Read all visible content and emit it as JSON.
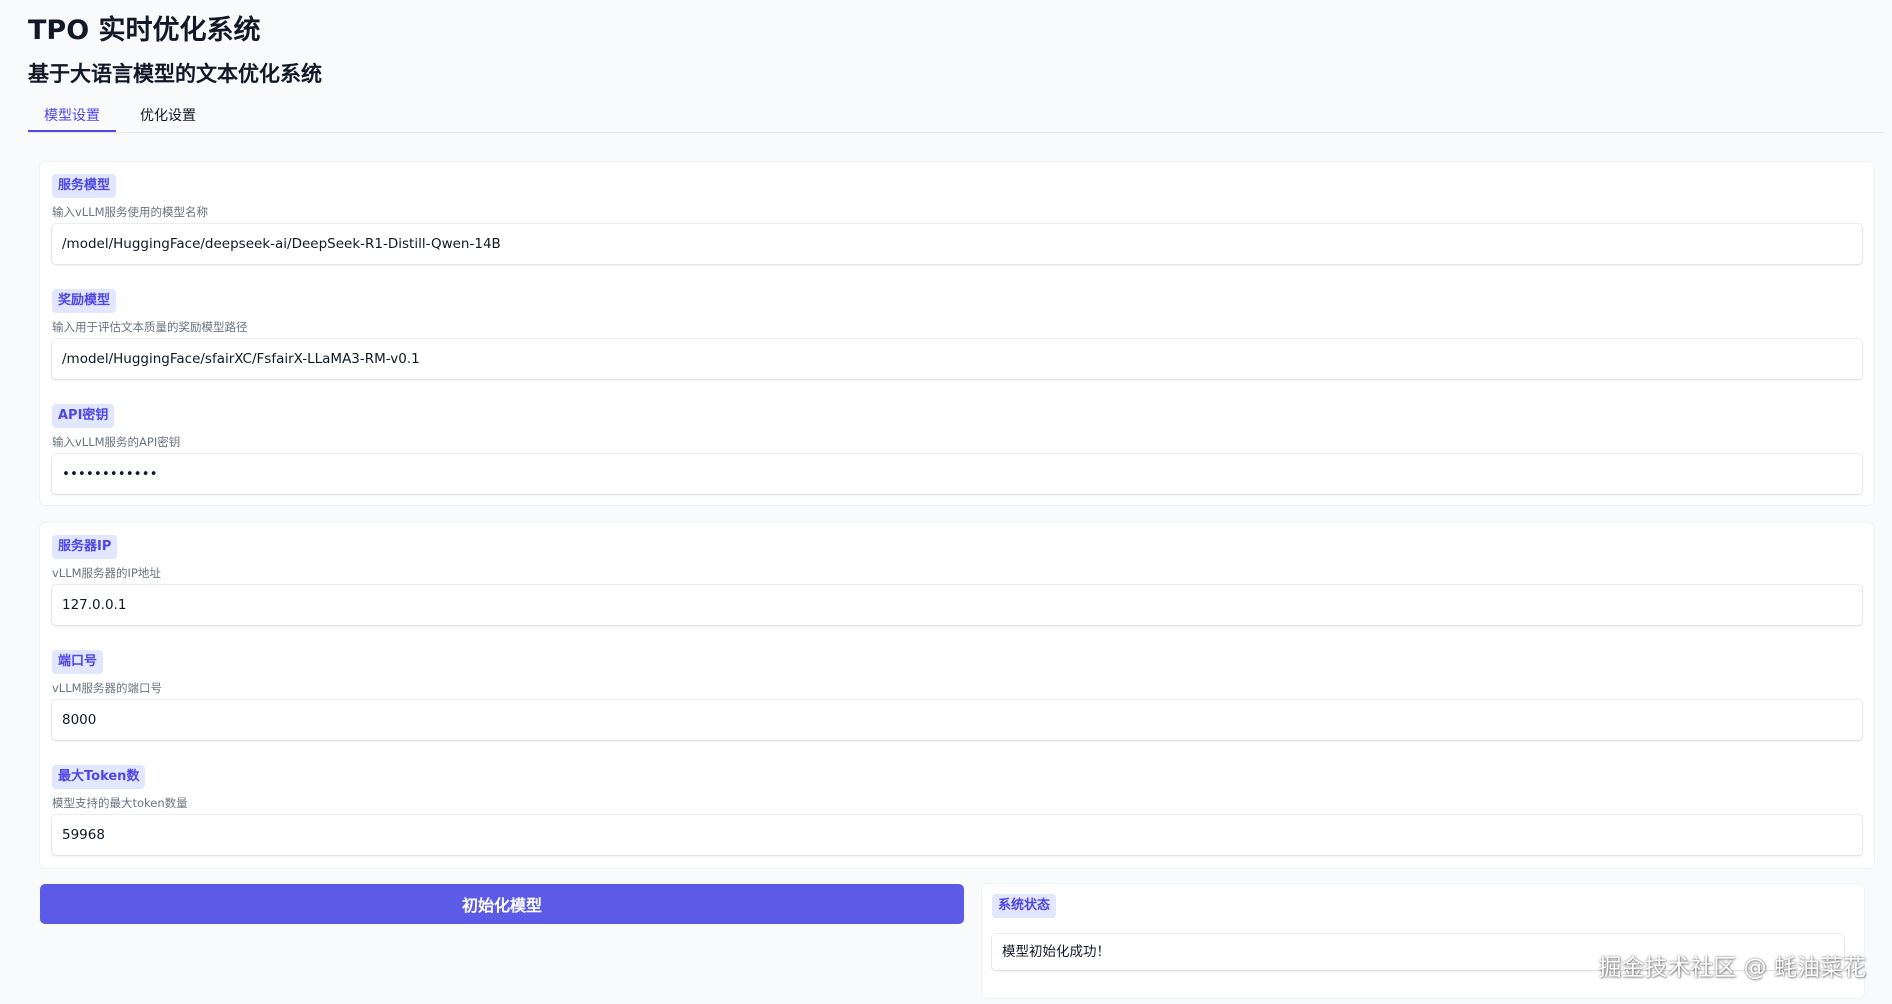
{
  "header": {
    "title": "TPO 实时优化系统",
    "subtitle": "基于大语言模型的文本优化系统"
  },
  "tabs": [
    {
      "label": "模型设置",
      "active": true
    },
    {
      "label": "优化设置",
      "active": false
    }
  ],
  "model_settings": {
    "service_model": {
      "label": "服务模型",
      "info": "输入vLLM服务使用的模型名称",
      "value": "/model/HuggingFace/deepseek-ai/DeepSeek-R1-Distill-Qwen-14B"
    },
    "reward_model": {
      "label": "奖励模型",
      "info": "输入用于评估文本质量的奖励模型路径",
      "value": "/model/HuggingFace/sfairXC/FsfairX-LLaMA3-RM-v0.1"
    },
    "api_key": {
      "label": "API密钥",
      "info": "输入vLLM服务的API密钥",
      "value": "••••••••••••"
    }
  },
  "server_settings": {
    "server_ip": {
      "label": "服务器IP",
      "info": "vLLM服务器的IP地址",
      "value": "127.0.0.1"
    },
    "port": {
      "label": "端口号",
      "info": "vLLM服务器的端口号",
      "value": "8000"
    },
    "max_tokens": {
      "label": "最大Token数",
      "info": "模型支持的最大token数量",
      "value": "59968"
    }
  },
  "actions": {
    "init_label": "初始化模型"
  },
  "status": {
    "label": "系统状态",
    "text": "模型初始化成功！"
  },
  "watermark": "掘金技术社区 @ 蚝油菜花",
  "colors": {
    "accent": "#4f46e5",
    "button": "#5b5be8",
    "label_bg": "#e0e7ff",
    "background": "#f9fafb"
  }
}
